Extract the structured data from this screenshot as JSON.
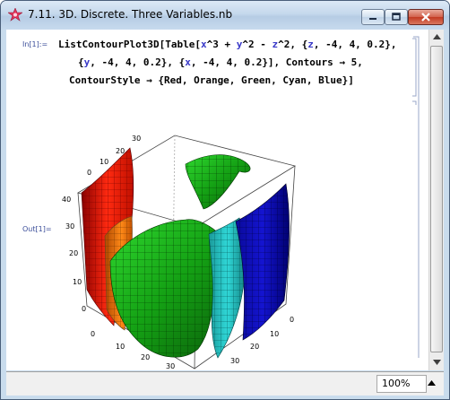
{
  "window": {
    "title": "7.11. 3D. Discrete. Three Variables.nb"
  },
  "controls": {
    "minimize": "minimize",
    "maximize": "maximize",
    "close": "close"
  },
  "cell": {
    "in_label": "In[1]:=",
    "out_label": "Out[1]=",
    "code": {
      "line1_a": "ListContourPlot3D[Table[",
      "line1_x": "x",
      "line1_b": "^3 + ",
      "line1_y": "y",
      "line1_c": "^2 - ",
      "line1_z": "z",
      "line1_d": "^2, {",
      "line1_z2": "z",
      "line1_e": ", -4, 4, 0.2},",
      "line2_a": "{",
      "line2_y": "y",
      "line2_b": ", -4, 4, 0.2}, {",
      "line2_x": "x",
      "line2_c": ", -4, 4, 0.2}], Contours → 5,",
      "line3": "ContourStyle → {Red, Orange, Green, Cyan, Blue}]"
    }
  },
  "plot": {
    "tick_labels_left": [
      "40",
      "30",
      "20",
      "10",
      "0"
    ],
    "tick_labels_top": [
      "40",
      "30",
      "20",
      "10"
    ],
    "tick_labels_zaxis": [
      "30",
      "20",
      "10",
      "0"
    ],
    "tick_labels_bottom_left": [
      "0",
      "10",
      "20",
      "30",
      "40"
    ],
    "tick_labels_bottom_right": [
      "0",
      "10",
      "20",
      "30",
      "40"
    ],
    "contour_colors": [
      "#ff0000",
      "#ff8000",
      "#00b000",
      "#00ffff",
      "#0000ff"
    ]
  },
  "statusbar": {
    "zoom": "100%"
  }
}
